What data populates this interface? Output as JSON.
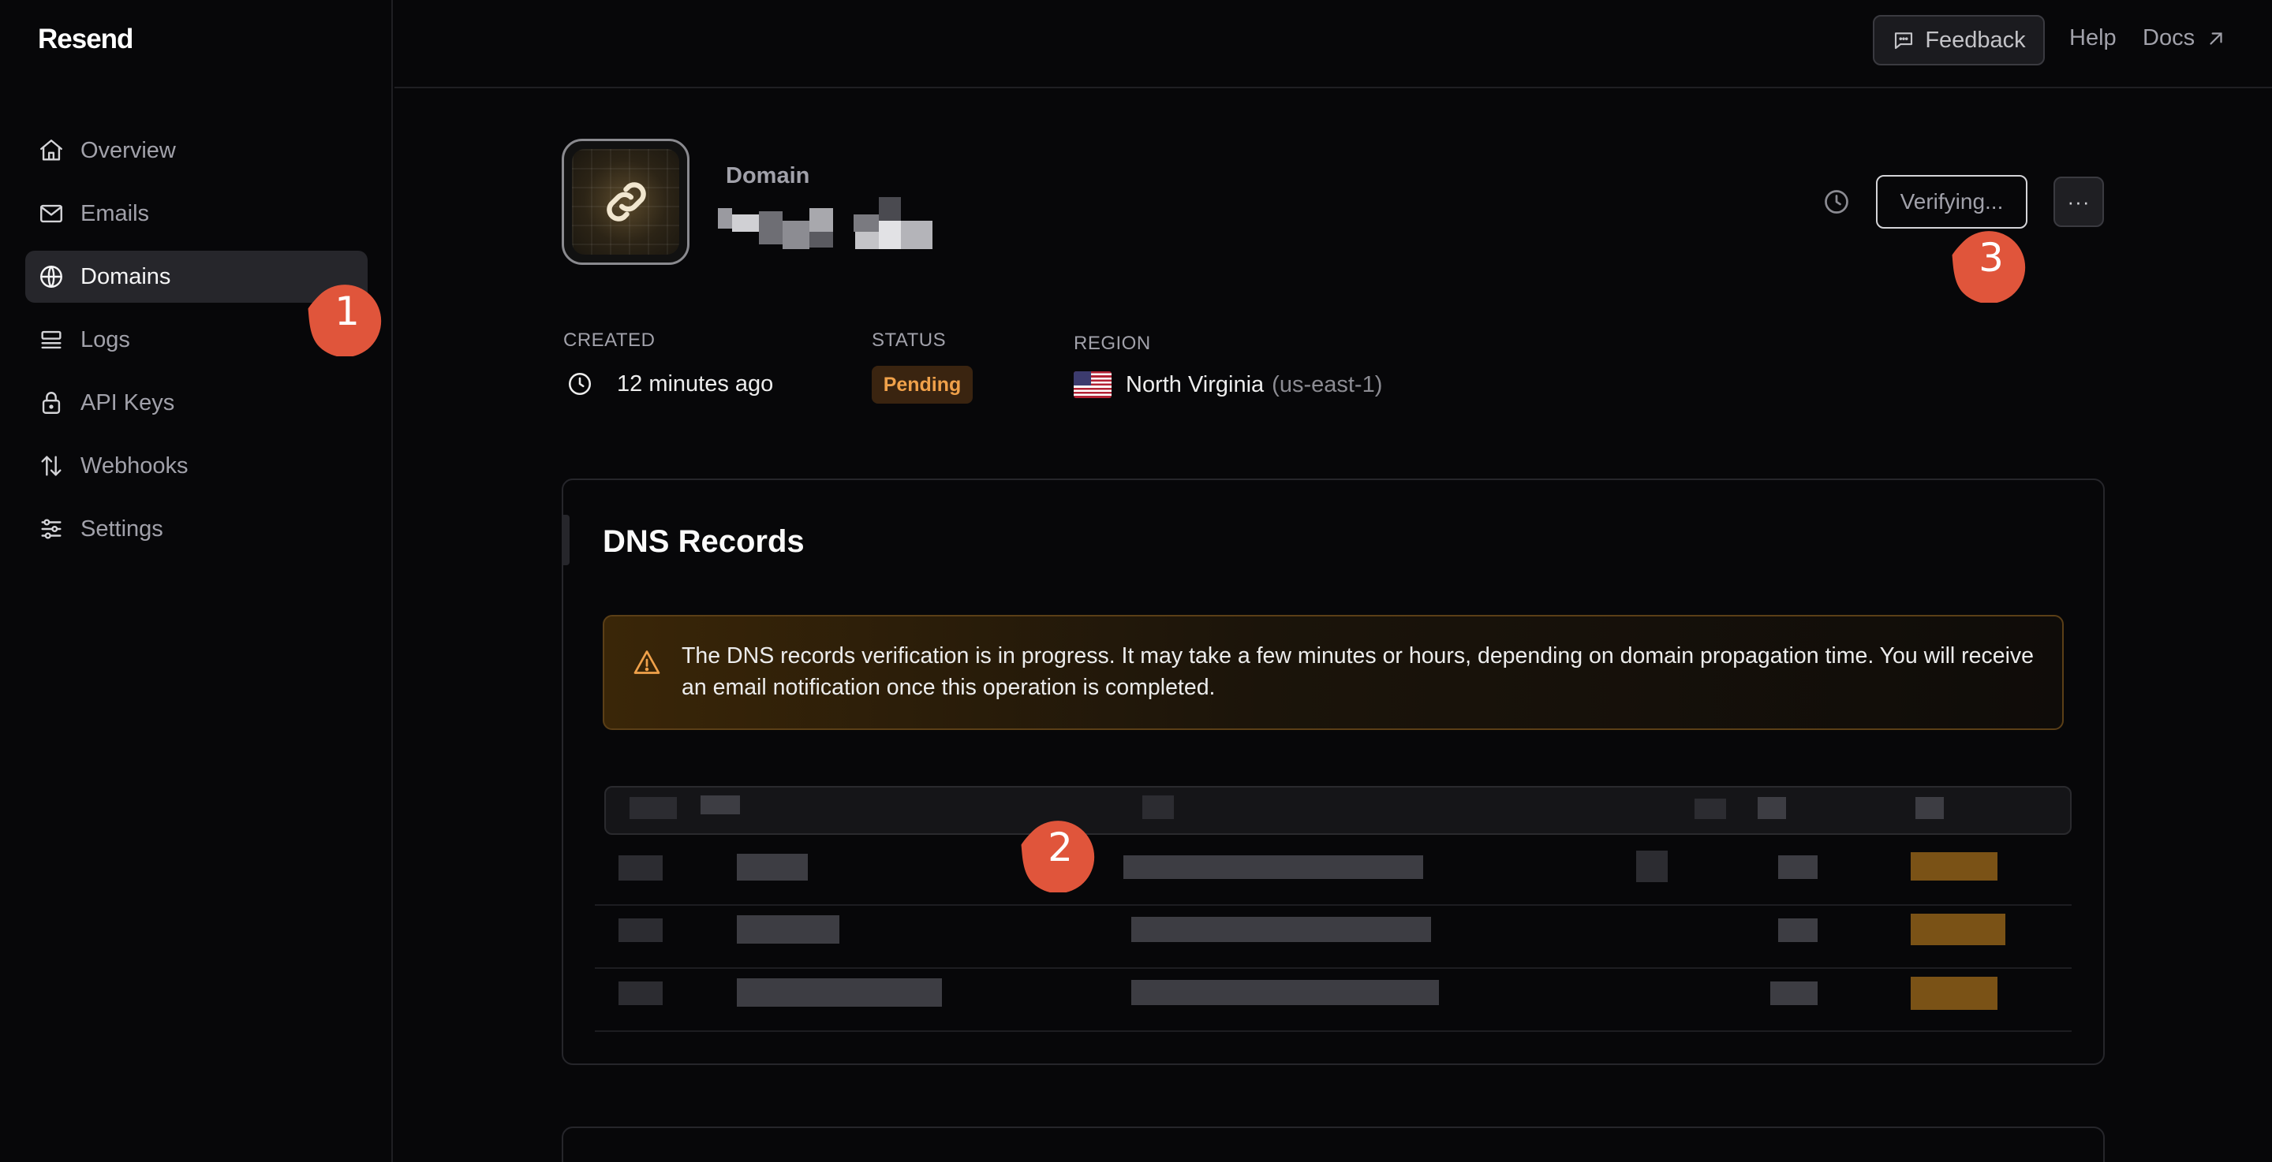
{
  "app": {
    "brand": "Resend"
  },
  "sidebar": {
    "items": [
      {
        "label": "Overview",
        "icon": "home-icon",
        "active": false
      },
      {
        "label": "Emails",
        "icon": "mail-icon",
        "active": false
      },
      {
        "label": "Domains",
        "icon": "globe-icon",
        "active": true
      },
      {
        "label": "Logs",
        "icon": "logs-icon",
        "active": false
      },
      {
        "label": "API Keys",
        "icon": "lock-icon",
        "active": false
      },
      {
        "label": "Webhooks",
        "icon": "webhook-icon",
        "active": false
      },
      {
        "label": "Settings",
        "icon": "sliders-icon",
        "active": false
      }
    ]
  },
  "topbar": {
    "feedback": "Feedback",
    "help": "Help",
    "docs": "Docs"
  },
  "domain": {
    "label": "Domain",
    "verify_button": "Verifying...",
    "more_button": "···",
    "created_label": "CREATED",
    "created_value": "12 minutes ago",
    "status_label": "STATUS",
    "status_value": "Pending",
    "region_label": "REGION",
    "region_value": "North Virginia",
    "region_code": "(us-east-1)"
  },
  "dns": {
    "title": "DNS Records",
    "alert": "The DNS records verification is in progress. It may take a few minutes or hours, depending on domain propagation time. You will receive an email notification once this operation is completed."
  },
  "markers": [
    "1",
    "2",
    "3"
  ],
  "colors": {
    "accent_marker": "#e0553b",
    "pending": "#f0a14a",
    "background": "#070709"
  }
}
